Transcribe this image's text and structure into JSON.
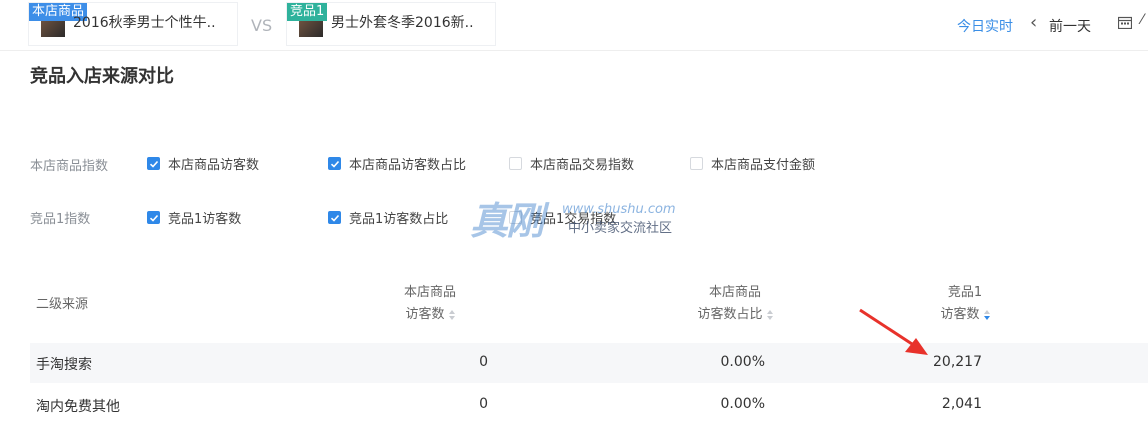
{
  "header": {
    "my_product": {
      "tag": "本店商品",
      "name": "2016秋季男士个性牛.."
    },
    "vs": "VS",
    "competitor": {
      "tag": "竞品1",
      "name": "男士外套冬季2016新.."
    },
    "today_label": "今日实时",
    "prev_day_label": "前一天"
  },
  "section_title": "竞品入店来源对比",
  "filters": {
    "mine": {
      "label": "本店商品指数",
      "options": [
        {
          "label": "本店商品访客数",
          "checked": true
        },
        {
          "label": "本店商品访客数占比",
          "checked": true
        },
        {
          "label": "本店商品交易指数",
          "checked": false
        },
        {
          "label": "本店商品支付金额",
          "checked": false
        }
      ]
    },
    "competitor": {
      "label": "竞品1指数",
      "options": [
        {
          "label": "竞品1访客数",
          "checked": true
        },
        {
          "label": "竞品1访客数占比",
          "checked": true
        },
        {
          "label": "竞品1交易指数",
          "checked": false
        }
      ]
    }
  },
  "watermark": {
    "big": "真刚",
    "url": "www.shushu.com",
    "sub": "中小卖家交流社区"
  },
  "table": {
    "headers": {
      "source": "二级来源",
      "my_visitors_l1": "本店商品",
      "my_visitors_l2": "访客数",
      "my_ratio_l1": "本店商品",
      "my_ratio_l2": "访客数占比",
      "comp_visitors_l1": "竞品1",
      "comp_visitors_l2": "访客数"
    },
    "rows": [
      {
        "source": "手淘搜索",
        "my_visitors": "0",
        "my_ratio": "0.00%",
        "comp_visitors": "20,217"
      },
      {
        "source": "淘内免费其他",
        "my_visitors": "0",
        "my_ratio": "0.00%",
        "comp_visitors": "2,041"
      }
    ]
  },
  "colors": {
    "accent": "#2f88e8",
    "arrow": "#e8322b"
  }
}
